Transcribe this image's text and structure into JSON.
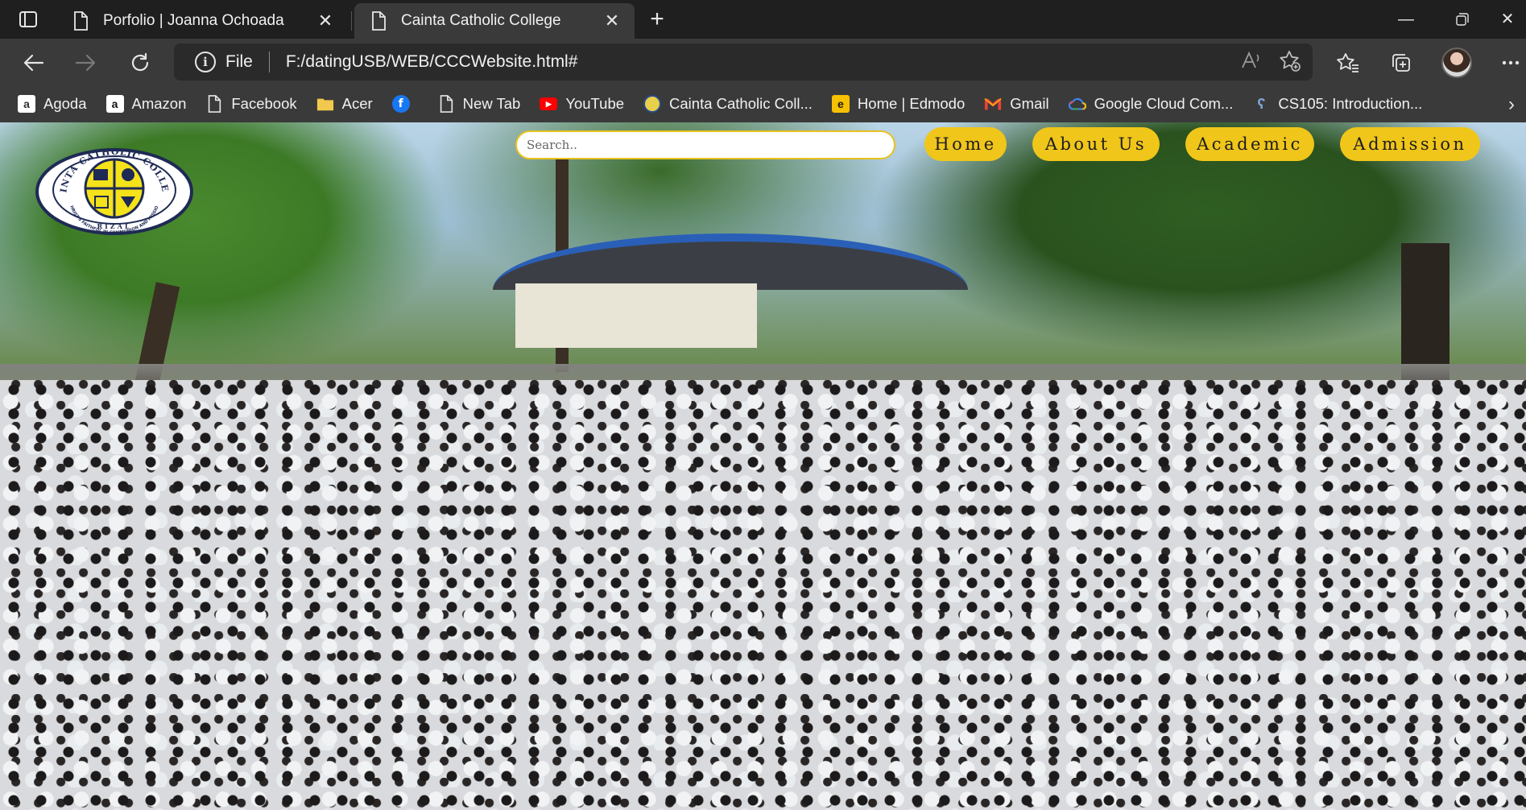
{
  "browser": {
    "tabs": [
      {
        "title": "Porfolio | Joanna Ochoada",
        "active": false,
        "icon": "page-icon"
      },
      {
        "title": "Cainta Catholic College",
        "active": true,
        "icon": "page-icon"
      }
    ],
    "address": {
      "scheme_label": "File",
      "url": "F:/datingUSB/WEB/CCCWebsite.html#"
    },
    "bookmarks": [
      {
        "label": "Agoda",
        "icon": "agoda-icon"
      },
      {
        "label": "Amazon",
        "icon": "amazon-icon"
      },
      {
        "label": "Facebook",
        "icon": "page-icon"
      },
      {
        "label": "Acer",
        "icon": "folder-icon"
      },
      {
        "label": "",
        "icon": "facebook-icon"
      },
      {
        "label": "New Tab",
        "icon": "page-icon"
      },
      {
        "label": "YouTube",
        "icon": "youtube-icon"
      },
      {
        "label": "Cainta Catholic Coll...",
        "icon": "school-seal-icon"
      },
      {
        "label": "Home | Edmodo",
        "icon": "edmodo-icon"
      },
      {
        "label": "Gmail",
        "icon": "gmail-icon"
      },
      {
        "label": "Google Cloud Com...",
        "icon": "google-cloud-icon"
      },
      {
        "label": "CS105: Introduction...",
        "icon": "course-icon"
      }
    ]
  },
  "site": {
    "logo": {
      "top_text": "CAINTA CATHOLIC COLLEGE",
      "bottom_text": "RIZAL",
      "motto": "CHRIST'S FAITHFUL IN COMMUNION AND MISSION"
    },
    "search": {
      "placeholder": "Search.."
    },
    "nav": [
      {
        "label": "Home"
      },
      {
        "label": "About Us"
      },
      {
        "label": "Academic"
      },
      {
        "label": "Admission"
      }
    ],
    "colors": {
      "accent": "#f0c61a",
      "search_border": "#e8c21d"
    }
  }
}
